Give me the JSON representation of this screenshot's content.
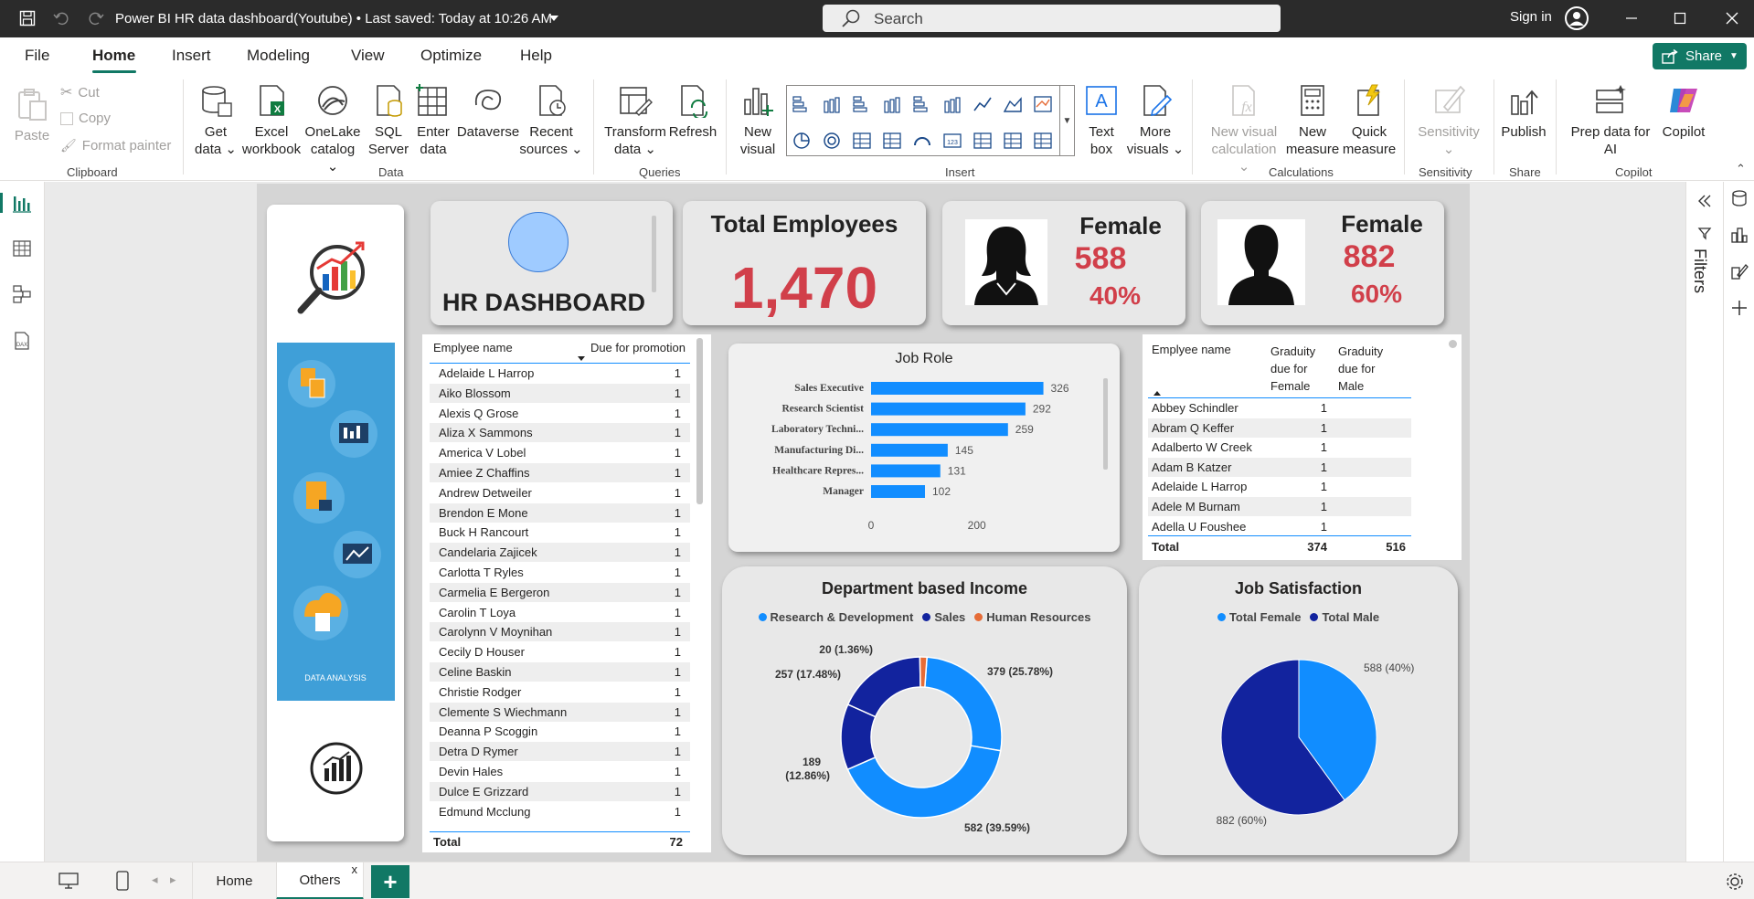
{
  "titlebar": {
    "title": "Power BI HR data dashboard(Youtube) • Last saved: Today at 10:26 AM",
    "search_placeholder": "Search",
    "signin": "Sign in"
  },
  "menu": {
    "items": [
      "File",
      "Home",
      "Insert",
      "Modeling",
      "View",
      "Optimize",
      "Help"
    ],
    "share": "Share"
  },
  "ribbon": {
    "clipboard": {
      "paste": "Paste",
      "cut": "Cut",
      "copy": "Copy",
      "format_painter": "Format painter",
      "group": "Clipboard"
    },
    "data": {
      "get_data": [
        "Get",
        "data"
      ],
      "excel": [
        "Excel",
        "workbook"
      ],
      "onelake": [
        "OneLake",
        "catalog"
      ],
      "sql": [
        "SQL",
        "Server"
      ],
      "enter": [
        "Enter",
        "data"
      ],
      "dataverse": "Dataverse",
      "recent": [
        "Recent",
        "sources"
      ],
      "group": "Data"
    },
    "queries": {
      "transform": [
        "Transform",
        "data"
      ],
      "refresh": "Refresh",
      "group": "Queries"
    },
    "insert": {
      "new_visual": [
        "New",
        "visual"
      ],
      "text_box": [
        "Text",
        "box"
      ],
      "more_visuals": [
        "More",
        "visuals"
      ],
      "group": "Insert"
    },
    "calculations": {
      "new_visual_calc": [
        "New visual",
        "calculation"
      ],
      "new_measure": [
        "New",
        "measure"
      ],
      "quick_measure": [
        "Quick",
        "measure"
      ],
      "group": "Calculations"
    },
    "sensitivity": {
      "label": "Sensitivity",
      "group": "Sensitivity"
    },
    "share": {
      "publish": "Publish",
      "group": "Share"
    },
    "copilot": {
      "prep": [
        "Prep data for",
        "AI"
      ],
      "copilot": "Copilot",
      "group": "Copilot"
    }
  },
  "filters_label": "Filters",
  "pages": {
    "tabs": [
      "Home",
      "Others"
    ],
    "close": "x",
    "add": "+"
  },
  "report": {
    "side_caption": "DATA ANALYSIS",
    "hr_title": "HR DASHBOARD",
    "total_employees": {
      "label": "Total Employees",
      "value": "1,470"
    },
    "female_card_1": {
      "label": "Female",
      "count": "588",
      "pct": "40%"
    },
    "female_card_2": {
      "label": "Female",
      "count": "882",
      "pct": "60%"
    },
    "promotion_table": {
      "headers": [
        "Emplyee name",
        "Due for promotion"
      ],
      "rows": [
        [
          "Adelaide L Harrop",
          "1"
        ],
        [
          "Aiko Blossom",
          "1"
        ],
        [
          "Alexis Q Grose",
          "1"
        ],
        [
          "Aliza X Sammons",
          "1"
        ],
        [
          "America V Lobel",
          "1"
        ],
        [
          "Amiee Z Chaffins",
          "1"
        ],
        [
          "Andrew Detweiler",
          "1"
        ],
        [
          "Brendon E Mone",
          "1"
        ],
        [
          "Buck H Rancourt",
          "1"
        ],
        [
          "Candelaria Zajicek",
          "1"
        ],
        [
          "Carlotta T Ryles",
          "1"
        ],
        [
          "Carmelia E Bergeron",
          "1"
        ],
        [
          "Carolin T Loya",
          "1"
        ],
        [
          "Carolynn V Moynihan",
          "1"
        ],
        [
          "Cecily D Houser",
          "1"
        ],
        [
          "Celine Baskin",
          "1"
        ],
        [
          "Christie Rodger",
          "1"
        ],
        [
          "Clemente S Wiechmann",
          "1"
        ],
        [
          "Deanna P Scoggin",
          "1"
        ],
        [
          "Detra D Rymer",
          "1"
        ],
        [
          "Devin Hales",
          "1"
        ],
        [
          "Dulce E Grizzard",
          "1"
        ],
        [
          "Edmund Mcclung",
          "1"
        ]
      ],
      "total_label": "Total",
      "total_value": "72"
    },
    "gratuity_table": {
      "headers": [
        "Emplyee name",
        "Graduity due for Female",
        "Graduity due for Male"
      ],
      "rows": [
        [
          "Abbey Schindler",
          "1",
          ""
        ],
        [
          "Abram Q Keffer",
          "1",
          ""
        ],
        [
          "Adalberto W Creek",
          "1",
          ""
        ],
        [
          "Adam B Katzer",
          "1",
          ""
        ],
        [
          "Adelaide L Harrop",
          "1",
          ""
        ],
        [
          "Adele M Burnam",
          "1",
          ""
        ],
        [
          "Adella U Foushee",
          "1",
          ""
        ]
      ],
      "total_label": "Total",
      "total_female": "374",
      "total_male": "516"
    }
  },
  "chart_data": [
    {
      "type": "bar",
      "orientation": "horizontal",
      "title": "Job Role",
      "categories": [
        "Sales Executive",
        "Research Scientist",
        "Laboratory Techni...",
        "Manufacturing Di...",
        "Healthcare Repres...",
        "Manager"
      ],
      "values": [
        326,
        292,
        259,
        145,
        131,
        102
      ],
      "xticks": [
        "0",
        "200"
      ],
      "xlim": [
        0,
        370
      ],
      "color": "#118dff"
    },
    {
      "type": "pie",
      "donut": true,
      "title": "Department based Income",
      "legend": [
        "Research & Development",
        "Sales",
        "Human Resources"
      ],
      "legend_colors": [
        "#118dff",
        "#12239e",
        "#e66c37"
      ],
      "slices": [
        {
          "value": 379,
          "label": "379 (25.78%)",
          "color": "#118dff"
        },
        {
          "value": 582,
          "label": "582 (39.59%)",
          "color": "#118dff"
        },
        {
          "value": 189,
          "label": "189 (12.86%)",
          "color": "#12239e"
        },
        {
          "value": 257,
          "label": "257 (17.48%)",
          "color": "#12239e"
        },
        {
          "value": 20,
          "label": "20 (1.36%)",
          "color": "#e66c37"
        }
      ],
      "legend_position": "top"
    },
    {
      "type": "pie",
      "title": "Job Satisfaction",
      "legend": [
        "Total Female",
        "Total Male"
      ],
      "legend_colors": [
        "#118dff",
        "#12239e"
      ],
      "slices": [
        {
          "value": 588,
          "label": "588 (40%)",
          "color": "#118dff"
        },
        {
          "value": 882,
          "label": "882 (60%)",
          "color": "#12239e"
        }
      ],
      "legend_position": "top"
    }
  ]
}
